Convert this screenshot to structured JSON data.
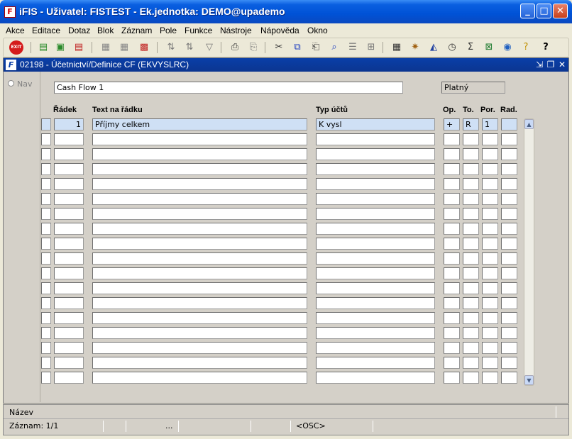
{
  "window": {
    "title": "iFIS - Uživatel: FISTEST - Ek.jednotka: DEMO@upademo",
    "min_glyph": "_",
    "max_glyph": "□",
    "close_glyph": "✕"
  },
  "menu": [
    "Akce",
    "Editace",
    "Dotaz",
    "Blok",
    "Záznam",
    "Pole",
    "Funkce",
    "Nástroje",
    "Nápověda",
    "Okno"
  ],
  "toolbar": {
    "exit_label": "EXIT",
    "icons": [
      "exit-icon",
      "insert-record-icon",
      "duplicate-record-icon",
      "delete-record-icon",
      "save-icon",
      "refresh-icon",
      "clear-icon",
      "sort-asc-icon",
      "sort-desc-icon",
      "filter-icon",
      "print-icon",
      "print-preview-icon",
      "cut-icon",
      "copy-icon",
      "paste-icon",
      "find-icon",
      "list-icon",
      "tree-icon",
      "calculator-icon",
      "settings-icon",
      "navigate-icon",
      "clock-icon",
      "sum-icon",
      "excel-icon",
      "export-icon",
      "help-lock-icon",
      "help-icon"
    ]
  },
  "form": {
    "title": "02198 - Účetnictví/Definice CF (EKVYSLRC)",
    "icon_label": "F",
    "nav_label": "Nav",
    "name_value": "Cash Flow 1",
    "status_value": "Platný",
    "headers": {
      "radek": "Řádek",
      "text": "Text na řádku",
      "typ": "Typ účtů",
      "op": "Op.",
      "to": "To.",
      "por": "Por.",
      "rad": "Rad."
    },
    "rows": [
      {
        "radek": "1",
        "text": "Příjmy celkem",
        "typ": "K vysl",
        "op": "+",
        "to": "R",
        "por": "1",
        "rad": ""
      }
    ],
    "empty_rows": 17
  },
  "status": {
    "label": "Název",
    "record": "Záznam: 1/1",
    "ellipsis": "...",
    "mode": "<OSC>"
  }
}
